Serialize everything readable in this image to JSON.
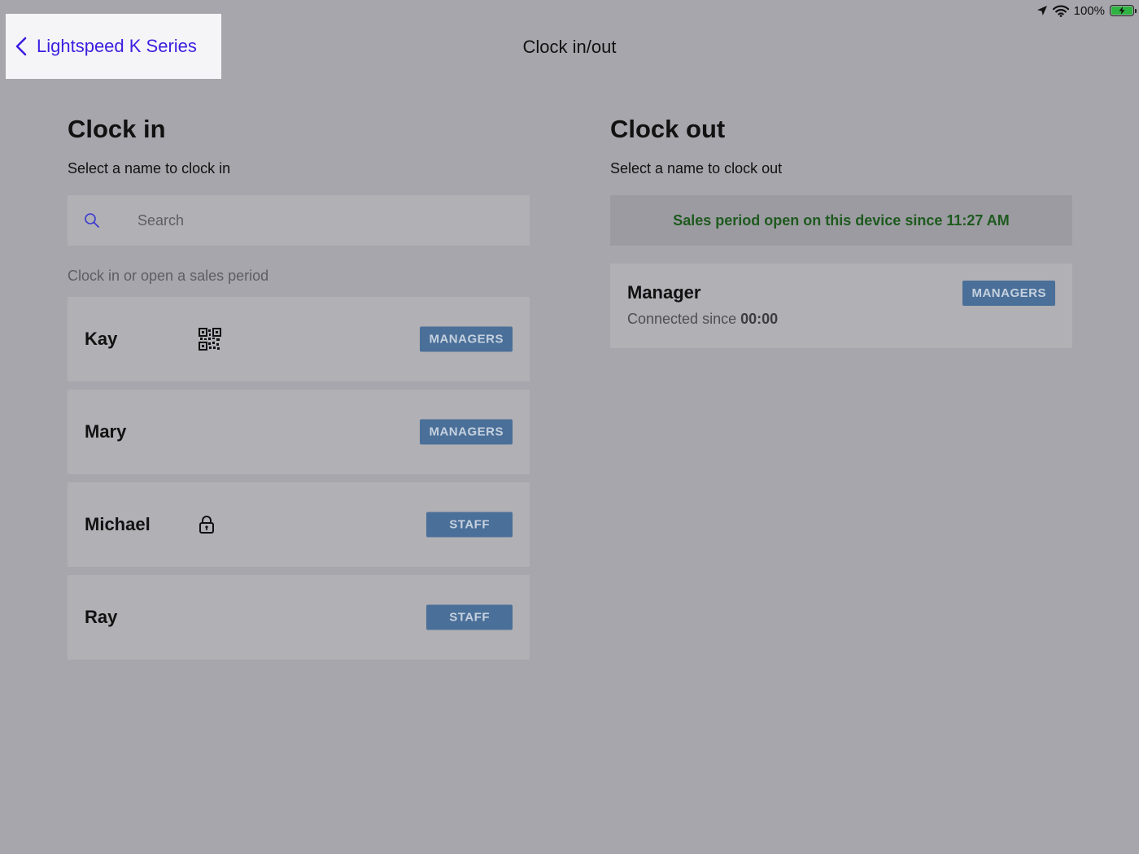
{
  "status_bar": {
    "battery_percent": "100%",
    "icons": [
      "location-arrow-icon",
      "wifi-icon",
      "battery-charging-icon"
    ]
  },
  "nav": {
    "back_label": "Lightspeed K Series",
    "title": "Clock in/out"
  },
  "clock_in": {
    "title": "Clock in",
    "subtitle": "Select a name to clock in",
    "search_placeholder": "Search",
    "section_label": "Clock in or open a sales period",
    "people": [
      {
        "name": "Kay",
        "icon": "qr-code-icon",
        "role": "MANAGERS"
      },
      {
        "name": "Mary",
        "icon": "",
        "role": "MANAGERS"
      },
      {
        "name": "Michael",
        "icon": "lock-icon",
        "role": "STAFF"
      },
      {
        "name": "Ray",
        "icon": "",
        "role": "STAFF"
      }
    ]
  },
  "clock_out": {
    "title": "Clock out",
    "subtitle": "Select a name to clock out",
    "sales_banner": "Sales period open on this device since 11:27 AM",
    "connected": {
      "name": "Manager",
      "role": "MANAGERS",
      "prefix": "Connected since",
      "time": "00:00"
    }
  },
  "colors": {
    "background": "#a7a6ac",
    "card": "#b1b0b5",
    "badge": "#4a6f98",
    "back_link": "#3b1ee0",
    "banner_text": "#1e5a1e"
  }
}
